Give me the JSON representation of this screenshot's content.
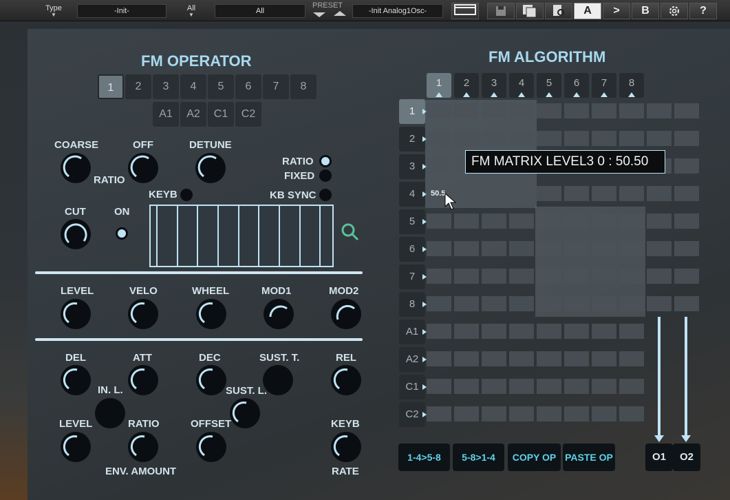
{
  "toolbar": {
    "type_label": "Type",
    "type_value": "-Init-",
    "all_label": "All",
    "all_value": "All",
    "preset_label": "PRESET",
    "preset_value": "-Init Analog1Osc-",
    "btn_a": "A",
    "btn_arrow": ">",
    "btn_b": "B",
    "btn_help": "?"
  },
  "operator": {
    "title": "FM OPERATOR",
    "tabs": [
      "1",
      "2",
      "3",
      "4",
      "5",
      "6",
      "7",
      "8"
    ],
    "tabs2": [
      "A1",
      "A2",
      "C1",
      "C2"
    ],
    "coarse": "COARSE",
    "off": "OFF",
    "detune": "DETUNE",
    "ratio_small": "RATIO",
    "ratio": "RATIO",
    "fixed": "FIXED",
    "keyb": "KEYB",
    "kb_sync": "KB SYNC",
    "cut": "CUT",
    "on": "ON",
    "level": "LEVEL",
    "velo": "VELO",
    "wheel": "WHEEL",
    "mod1": "MOD1",
    "mod2": "MOD2",
    "del": "DEL",
    "att": "ATT",
    "dec": "DEC",
    "sust_t": "SUST. T.",
    "rel": "REL",
    "in_l": "IN. L.",
    "sust_l": "SUST. L.",
    "level2": "LEVEL",
    "ratio2": "RATIO",
    "offset": "OFFSET",
    "keyb2": "KEYB",
    "env_amount": "ENV. AMOUNT",
    "rate": "RATE"
  },
  "algorithm": {
    "title": "FM ALGORITHM",
    "cols": [
      "1",
      "2",
      "3",
      "4",
      "5",
      "6",
      "7",
      "8"
    ],
    "rows": [
      "1",
      "2",
      "3",
      "4",
      "5",
      "6",
      "7",
      "8",
      "A1",
      "A2",
      "C1",
      "C2"
    ],
    "tooltip": "FM MATRIX LEVEL3 0 : 50.50",
    "cell_value": "50.5",
    "btn_1": "1-4>5-8",
    "btn_2": "5-8>1-4",
    "btn_copy": "COPY OP",
    "btn_paste": "PASTE OP",
    "out1": "O1",
    "out2": "O2"
  },
  "colors": {
    "accent": "#bfe3f5",
    "title": "#a8d9ef",
    "button_text": "#5fd2e8"
  }
}
